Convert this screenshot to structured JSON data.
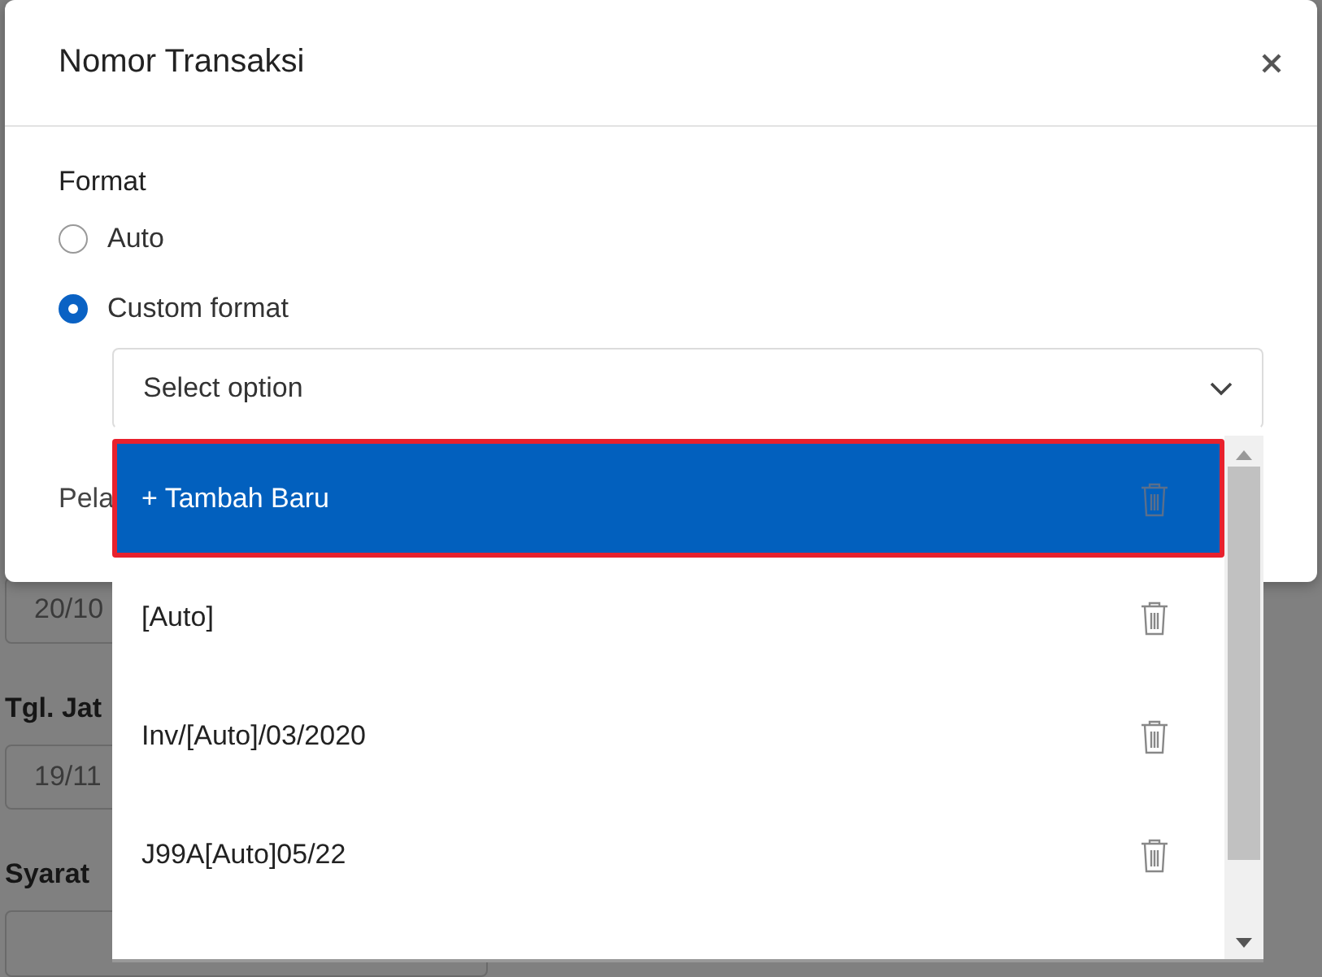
{
  "background_form": {
    "fields": [
      {
        "value": "20/10"
      },
      {
        "label": "Tgl. Jat",
        "value": "19/11"
      },
      {
        "label": "Syarat"
      }
    ]
  },
  "dialog": {
    "title": "Nomor Transaksi",
    "format_label": "Format",
    "radios": [
      {
        "label": "Auto",
        "selected": false
      },
      {
        "label": "Custom format",
        "selected": true
      }
    ],
    "select": {
      "placeholder": "Select option",
      "expanded": true
    },
    "next_label": "Pela",
    "options": [
      {
        "label": "+ Tambah Baru",
        "selected": true
      },
      {
        "label": "[Auto]",
        "selected": false
      },
      {
        "label": "Inv/[Auto]/03/2020",
        "selected": false
      },
      {
        "label": "J99A[Auto]05/22",
        "selected": false
      }
    ]
  }
}
